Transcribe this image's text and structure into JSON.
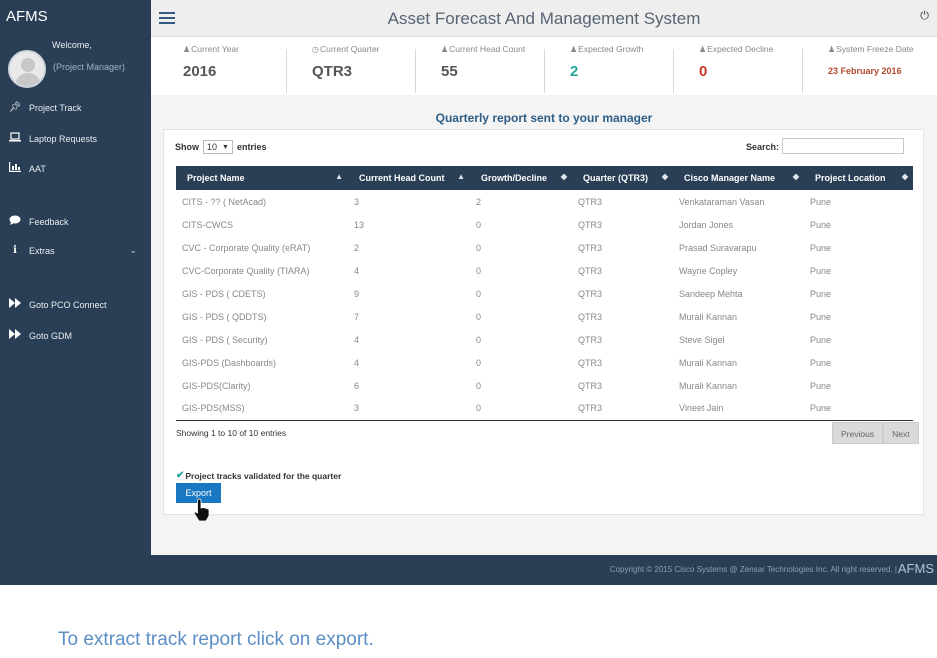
{
  "app": {
    "brand": "AFMS",
    "title": "Asset Forecast And Management System",
    "power_icon": "power-icon"
  },
  "user": {
    "welcome": "Welcome,",
    "role": "(Project Manager)"
  },
  "sidebar": {
    "items": [
      {
        "label": "Project Track",
        "icon": "pin-icon"
      },
      {
        "label": "Laptop Requests",
        "icon": "laptop-icon"
      },
      {
        "label": "AAT",
        "icon": "bar-chart-icon"
      },
      {
        "label": "Feedback",
        "icon": "comment-icon"
      },
      {
        "label": "Extras",
        "icon": "info-icon"
      },
      {
        "label": "Goto PCO Connect",
        "icon": "fast-forward-icon"
      },
      {
        "label": "Goto GDM",
        "icon": "fast-forward-icon"
      }
    ]
  },
  "stats": [
    {
      "label": "Current Year",
      "value": "2016"
    },
    {
      "label": "Current Quarter",
      "value": "QTR3"
    },
    {
      "label": "Current Head Count",
      "value": "55"
    },
    {
      "label": "Expected Growth",
      "value": "2"
    },
    {
      "label": "Expected Decline",
      "value": "0"
    },
    {
      "label": "System Freeze Date",
      "value": "23 February 2016"
    }
  ],
  "report": {
    "title": "Quarterly report sent to your manager",
    "show_label": "Show",
    "entries_value": "10",
    "entries_label": "entries",
    "search_label": "Search:",
    "search_value": "",
    "columns": [
      "Project Name",
      "Current Head Count",
      "Growth/Decline",
      "Quarter (QTR3)",
      "Cisco Manager Name",
      "Project Location"
    ],
    "rows": [
      [
        "CITS - ?? ( NetAcad)",
        "3",
        "2",
        "QTR3",
        "Venkataraman Vasan",
        "Pune"
      ],
      [
        "CITS-CWCS",
        "13",
        "0",
        "QTR3",
        "Jordan Jones",
        "Pune"
      ],
      [
        "CVC - Corporate Quality (eRAT)",
        "2",
        "0",
        "QTR3",
        "Prasad Suravarapu",
        "Pune"
      ],
      [
        "CVC-Corporate Quality (TIARA)",
        "4",
        "0",
        "QTR3",
        "Wayne Copley",
        "Pune"
      ],
      [
        "GIS - PDS ( CDETS)",
        "9",
        "0",
        "QTR3",
        "Sandeep Mehta",
        "Pune"
      ],
      [
        "GIS - PDS ( QDDTS)",
        "7",
        "0",
        "QTR3",
        "Murali Kannan",
        "Pune"
      ],
      [
        "GIS - PDS ( Security)",
        "4",
        "0",
        "QTR3",
        "Steve Sigel",
        "Pune"
      ],
      [
        "GIS-PDS (Dashboards)",
        "4",
        "0",
        "QTR3",
        "Murali Kannan",
        "Pune"
      ],
      [
        "GIS-PDS(Clarity)",
        "6",
        "0",
        "QTR3",
        "Murali Kannan",
        "Pune"
      ],
      [
        "GIS-PDS(MSS)",
        "3",
        "0",
        "QTR3",
        "Vineet Jain",
        "Pune"
      ]
    ],
    "info": "Showing 1 to 10 of 10 entries",
    "previous_label": "Previous",
    "next_label": "Next",
    "validated_text": "Project tracks validated for the quarter",
    "export_label": "Export"
  },
  "footer": {
    "copyright": "Copyright © 2015 Cisco Systems @ Zensar Technologies Inc. All right reserved. |",
    "brand": "AFMS"
  },
  "caption": "To extract track report click on export.",
  "colors": {
    "sidebar": "#2a3f55",
    "accent": "#1a78c2",
    "growth": "#25a79c",
    "decline": "#cc3a2a"
  }
}
